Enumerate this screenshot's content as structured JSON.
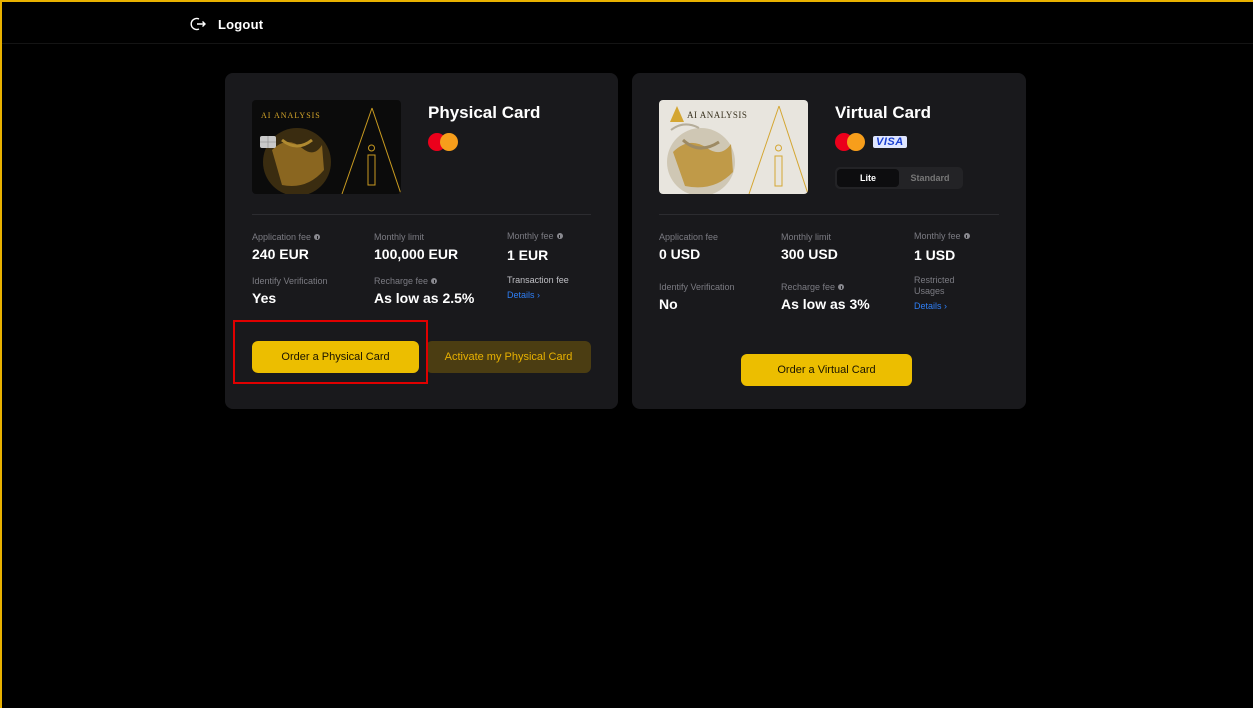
{
  "header": {
    "logout_label": "Logout"
  },
  "physical": {
    "title": "Physical Card",
    "card_brand_text": "AI ANALYSIS",
    "brands": [
      "mastercard-icon"
    ],
    "fields": {
      "application_fee_label": "Application fee",
      "application_fee_value": "240 EUR",
      "monthly_limit_label": "Monthly limit",
      "monthly_limit_value": "100,000 EUR",
      "monthly_fee_label": "Monthly fee",
      "monthly_fee_value": "1 EUR",
      "identify_label": "Identify Verification",
      "identify_value": "Yes",
      "recharge_label": "Recharge fee",
      "recharge_value": "As low as 2.5%",
      "transaction_label": "Transaction fee",
      "details_link": "Details ›"
    },
    "order_button": "Order a Physical Card",
    "activate_button": "Activate my Physical Card"
  },
  "virtual": {
    "title": "Virtual Card",
    "card_brand_text": "AI ANALYSIS",
    "brands": [
      "mastercard-icon",
      "visa-icon"
    ],
    "visa_text": "VISA",
    "toggle": {
      "options": [
        "Lite",
        "Standard"
      ],
      "selected": "Lite"
    },
    "fields": {
      "application_fee_label": "Application fee",
      "application_fee_value": "0 USD",
      "monthly_limit_label": "Monthly limit",
      "monthly_limit_value": "300 USD",
      "monthly_fee_label": "Monthly fee",
      "monthly_fee_value": "1 USD",
      "identify_label": "Identify Verification",
      "identify_value": "No",
      "recharge_label": "Recharge fee",
      "recharge_value": "As low as 3%",
      "restricted_label": "Restricted Usages",
      "details_link": "Details ›"
    },
    "order_button": "Order a Virtual Card"
  },
  "colors": {
    "accent": "#ecbe00",
    "link": "#2e7ef5",
    "highlight": "#e00000"
  }
}
